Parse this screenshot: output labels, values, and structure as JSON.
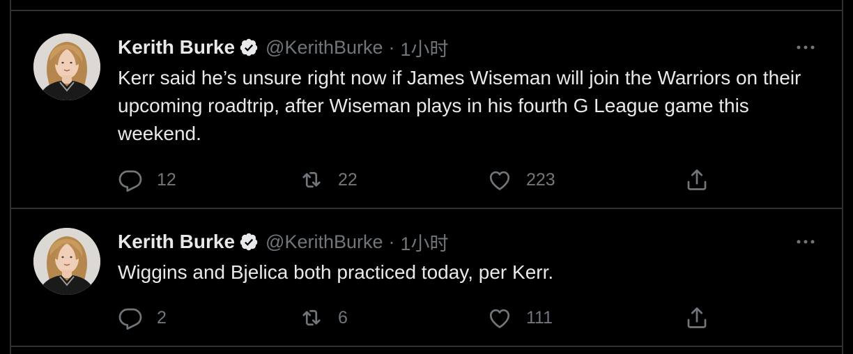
{
  "tweets": [
    {
      "author_name": "Kerith Burke",
      "handle": "@KerithBurke",
      "separator": "·",
      "time": "1小时",
      "text": "Kerr said he’s unsure right now if James Wiseman will join the Warriors on their upcoming roadtrip, after Wiseman plays in his fourth G League game this weekend.",
      "replies": "12",
      "retweets": "22",
      "likes": "223"
    },
    {
      "author_name": "Kerith Burke",
      "handle": "@KerithBurke",
      "separator": "·",
      "time": "1小时",
      "text": "Wiggins and Bjelica both practiced today, per Kerr.",
      "replies": "2",
      "retweets": "6",
      "likes": "111"
    }
  ],
  "colors": {
    "background": "#000000",
    "primary_text": "#e7e9ea",
    "secondary_text": "#71767b",
    "border": "#2f3336"
  },
  "icons": [
    "verified-badge-icon",
    "more-icon",
    "reply-icon",
    "retweet-icon",
    "like-icon",
    "share-icon"
  ]
}
